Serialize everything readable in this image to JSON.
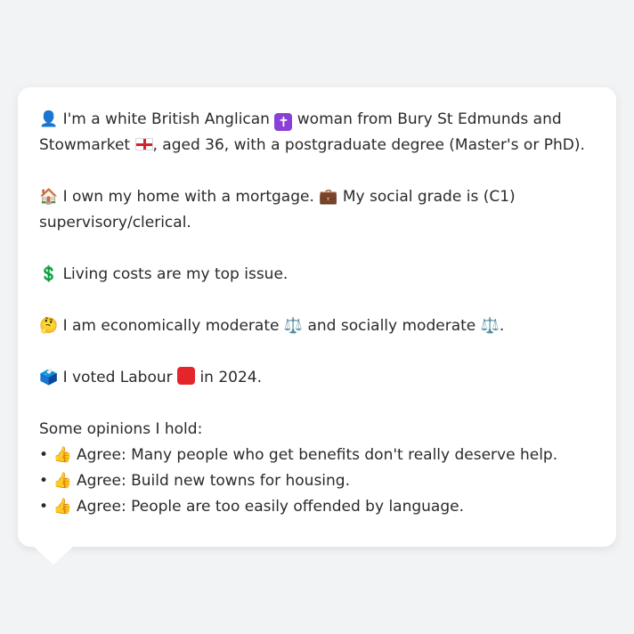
{
  "profile": {
    "intro_a": "I'm a white British Anglican",
    "intro_b": "woman from Bury St Edmunds and Stowmarket",
    "intro_c": ", aged 36, with a postgraduate degree (Master's or PhD).",
    "home_a": "I own my home with a mortgage.",
    "home_b": "My social grade is (C1) supervisory/clerical.",
    "issue": "Living costs are my top issue.",
    "ideology_a": "I am economically moderate",
    "ideology_b": "and socially moderate",
    "ideology_c": ".",
    "vote_a": "I voted Labour",
    "vote_b": "in 2024."
  },
  "icons": {
    "person": "👤",
    "cross": "✝",
    "home": "🏠",
    "briefcase": "💼",
    "dollar": "💲",
    "thinking": "🤔",
    "scales": "⚖️",
    "ballot": "🗳️",
    "thumbs_up": "👍"
  },
  "opinions": {
    "heading": "Some opinions I hold:",
    "bullet": "•",
    "items": [
      {
        "text": "Agree: Many people who get benefits don't really deserve help."
      },
      {
        "text": "Agree: Build new towns for housing."
      },
      {
        "text": "Agree: People are too easily offended by language."
      }
    ]
  },
  "colors": {
    "page_bg": "#f1f3f5",
    "bubble_bg": "#ffffff",
    "text": "#2a2a2a",
    "religion_badge": "#8a3fd6",
    "labour_badge": "#e6252a",
    "england_red": "#d6232b"
  }
}
